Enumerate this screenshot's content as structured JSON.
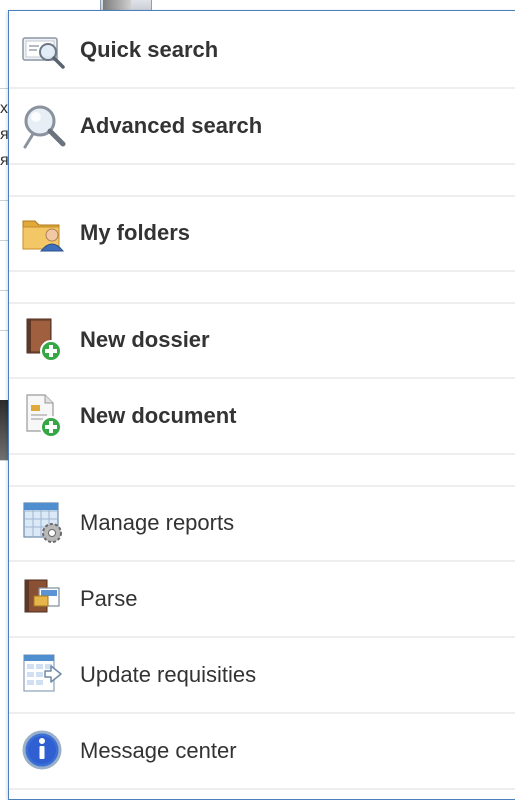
{
  "menu": {
    "items": [
      {
        "label": "Quick search",
        "icon": "quick-search-icon",
        "bold": true
      },
      {
        "label": "Advanced search",
        "icon": "magnifier-icon",
        "bold": true
      },
      {
        "label": "My folders",
        "icon": "user-folder-icon",
        "bold": true
      },
      {
        "label": "New dossier",
        "icon": "new-dossier-icon",
        "bold": true
      },
      {
        "label": "New document",
        "icon": "new-document-icon",
        "bold": true
      },
      {
        "label": "Manage reports",
        "icon": "reports-gear-icon",
        "bold": false
      },
      {
        "label": "Parse",
        "icon": "parse-icon",
        "bold": false
      },
      {
        "label": "Update requisities",
        "icon": "update-grid-icon",
        "bold": false
      },
      {
        "label": "Message center",
        "icon": "info-icon",
        "bold": false
      }
    ]
  },
  "background": {
    "left_edge_chars": [
      "x",
      "я",
      "я"
    ]
  },
  "colors": {
    "menu_border": "#4a7fc0",
    "separator": "#eeeeee",
    "text": "#333333",
    "add_badge": "#35a845",
    "info_blue": "#2f5fd0"
  }
}
